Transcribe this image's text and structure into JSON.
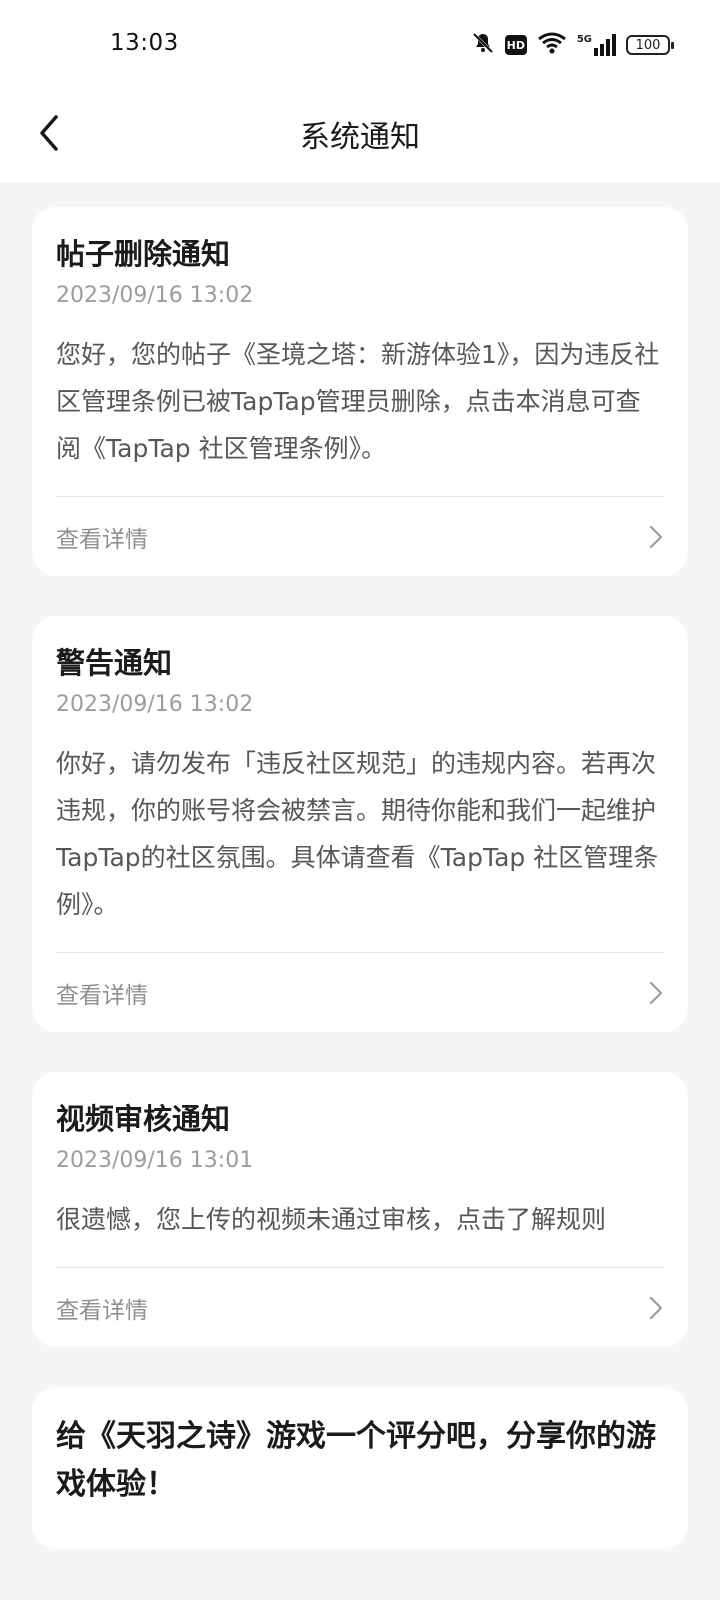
{
  "status": {
    "time": "13:03",
    "hd": "HD",
    "net": "5G",
    "battery": "100"
  },
  "header": {
    "title": "系统通知"
  },
  "notifications": [
    {
      "title": "帖子删除通知",
      "time": "2023/09/16 13:02",
      "body": "您好，您的帖子《圣境之塔：新游体验1》，因为违反社区管理条例已被TapTap管理员删除，点击本消息可查阅《TapTap 社区管理条例》。",
      "action": "查看详情"
    },
    {
      "title": "警告通知",
      "time": "2023/09/16 13:02",
      "body": "你好，请勿发布「违反社区规范」的违规内容。若再次违规，你的账号将会被禁言。期待你能和我们一起维护TapTap的社区氛围。具体请查看《TapTap 社区管理条例》。",
      "action": "查看详情"
    },
    {
      "title": "视频审核通知",
      "time": "2023/09/16 13:01",
      "body": "很遗憾，您上传的视频未通过审核，点击了解规则",
      "action": "查看详情"
    },
    {
      "title": "给《天羽之诗》游戏一个评分吧，分享你的游戏体验！"
    }
  ]
}
